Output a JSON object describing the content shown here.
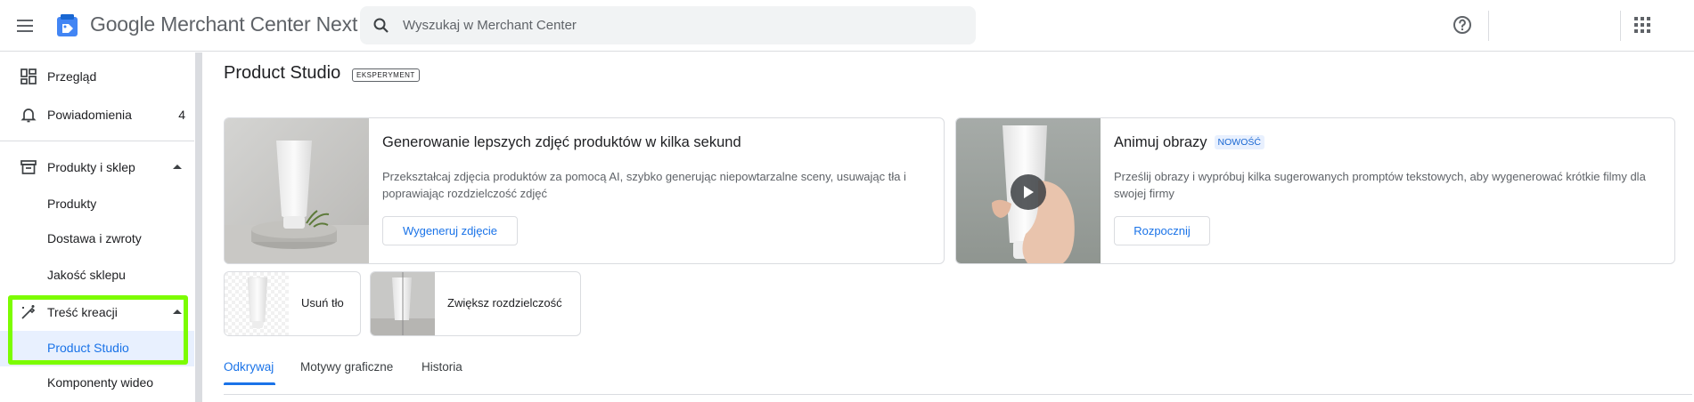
{
  "header": {
    "app_title": "Google Merchant Center Next",
    "search_placeholder": "Wyszukaj w Merchant Center"
  },
  "sidebar": {
    "items": [
      {
        "label": "Przegląd",
        "icon": "dashboard-icon"
      },
      {
        "label": "Powiadomienia",
        "icon": "bell-icon",
        "count": "4"
      },
      {
        "label": "Produkty i sklep",
        "icon": "store-icon",
        "expanded": true
      },
      {
        "label": "Produkty"
      },
      {
        "label": "Dostawa i zwroty"
      },
      {
        "label": "Jakość sklepu"
      },
      {
        "label": "Treść kreacji",
        "icon": "magic-pen-icon",
        "expanded": true
      },
      {
        "label": "Product Studio",
        "active": true
      },
      {
        "label": "Komponenty wideo"
      }
    ]
  },
  "main": {
    "title": "Product Studio",
    "badge": "EKSPERYMENT",
    "cards": [
      {
        "title": "Generowanie lepszych zdjęć produktów w kilka sekund",
        "description": "Przekształcaj zdjęcia produktów za pomocą AI, szybko generując niepowtarzalne sceny, usuwając tła i poprawiając rozdzielczość zdjęć",
        "button": "Wygeneruj zdjęcie"
      },
      {
        "title": "Animuj obrazy",
        "badge": "NOWOŚĆ",
        "description": "Prześlij obrazy i wypróbuj kilka sugerowanych promptów tekstowych, aby wygenerować krótkie filmy dla swojej firmy",
        "button": "Rozpocznij"
      }
    ],
    "mini_cards": [
      {
        "label": "Usuń tło"
      },
      {
        "label": "Zwiększ rozdzielczość"
      }
    ],
    "tabs": [
      {
        "label": "Odkrywaj",
        "active": true
      },
      {
        "label": "Motywy graficzne"
      },
      {
        "label": "Historia"
      }
    ]
  },
  "colors": {
    "accent": "#1a73e8",
    "highlight": "#7cfc00",
    "active_bg": "#e8f0fe"
  }
}
